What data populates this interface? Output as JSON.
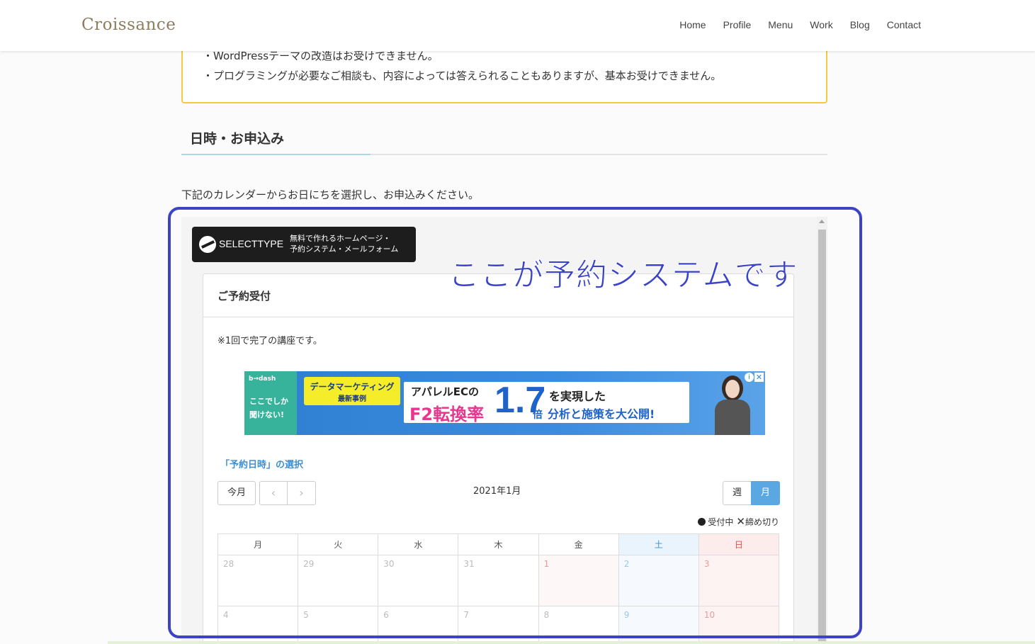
{
  "header": {
    "logo": "Croissance",
    "nav": [
      "Home",
      "Profile",
      "Menu",
      "Work",
      "Blog",
      "Contact"
    ]
  },
  "notice": {
    "line1": "・WordPressテーマの改造はお受けできません。",
    "line2": "・プログラミングが必要なご相談も、内容によっては答えられることもありますが、基本お受けできません。"
  },
  "section": {
    "title": "日時・お申込み",
    "intro": "下記のカレンダーからお日にちを選択し、お申込みください。"
  },
  "selecttype": {
    "name": "SELECTTYPE",
    "tag1": "無料で作れるホームページ・",
    "tag2": "予約システム・メールフォーム"
  },
  "annotation": "ここが予約システムです",
  "booking": {
    "title": "ご予約受付",
    "note": "※1回で完了の講座です。",
    "pick_title": "「予約日時」の選択",
    "today": "今月",
    "prev": "‹",
    "next": "›",
    "month_label": "2021年1月",
    "view_week": "週",
    "view_month": "月",
    "legend_open": "受付中",
    "legend_closed": "締め切り",
    "weekdays": [
      "月",
      "火",
      "水",
      "木",
      "金",
      "土",
      "日"
    ],
    "weeks": [
      [
        "28",
        "29",
        "30",
        "31",
        "1",
        "2",
        "3"
      ],
      [
        "4",
        "5",
        "6",
        "7",
        "8",
        "9",
        "10"
      ]
    ]
  },
  "ad": {
    "brand": "b→dash",
    "left1": "ここでしか",
    "left2": "聞けない!",
    "yellow1": "データマーケティング",
    "yellow2": "最新事例",
    "t1": "アパレルECの",
    "t2": "F2転換率",
    "big": "1.7",
    "unit": "倍",
    "t3": "を実現した",
    "t4": "分析と施策を大公開!",
    "colors": {
      "pink": "#e8358f",
      "blue": "#1e63c9",
      "yellow": "#f5ec2a"
    }
  },
  "colors": {
    "frame": "#3c43c4",
    "notice_border": "#f3cb3e",
    "accent_blue": "#5aa7e2"
  }
}
